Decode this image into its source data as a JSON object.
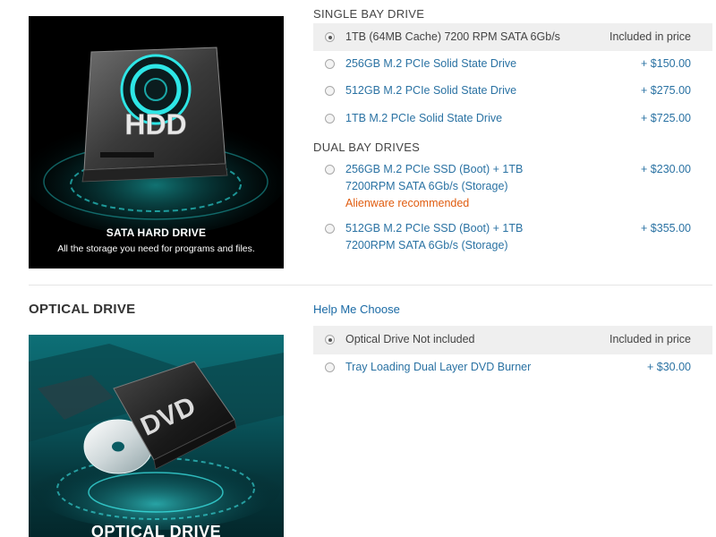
{
  "storage": {
    "promo": {
      "icon_text": "HDD",
      "title": "SATA HARD DRIVE",
      "subtitle": "All the storage you need for programs and files."
    },
    "single_bay": {
      "title": "SINGLE BAY DRIVE",
      "options": [
        {
          "label": "1TB (64MB Cache) 7200 RPM SATA 6Gb/s",
          "price": "Included in price",
          "selected": true
        },
        {
          "label": "256GB M.2 PCIe Solid State Drive",
          "price": "+ $150.00",
          "selected": false
        },
        {
          "label": "512GB M.2 PCIe Solid State Drive",
          "price": "+ $275.00",
          "selected": false
        },
        {
          "label": "1TB M.2 PCIe Solid State Drive",
          "price": "+ $725.00",
          "selected": false
        }
      ]
    },
    "dual_bay": {
      "title": "DUAL BAY DRIVES",
      "options": [
        {
          "label_line1": "256GB M.2 PCIe SSD (Boot) + 1TB",
          "label_line2": "7200RPM SATA 6Gb/s (Storage)",
          "recommended": "Alienware recommended",
          "price": "+ $230.00",
          "selected": false
        },
        {
          "label_line1": "512GB M.2 PCIe SSD (Boot) + 1TB",
          "label_line2": "7200RPM SATA 6Gb/s (Storage)",
          "price": "+ $355.00",
          "selected": false
        }
      ]
    }
  },
  "optical": {
    "heading": "OPTICAL DRIVE",
    "help_link": "Help Me Choose",
    "promo": {
      "icon_text": "DVD",
      "title": "OPTICAL DRIVE"
    },
    "options": [
      {
        "label": "Optical Drive Not included",
        "price": "Included in price",
        "selected": true
      },
      {
        "label": "Tray Loading Dual Layer DVD Burner",
        "price": "+ $30.00",
        "selected": false
      }
    ]
  },
  "colors": {
    "link": "#2a72a3",
    "recommended": "#e05c0f",
    "accent_teal": "#2ee6e6"
  }
}
